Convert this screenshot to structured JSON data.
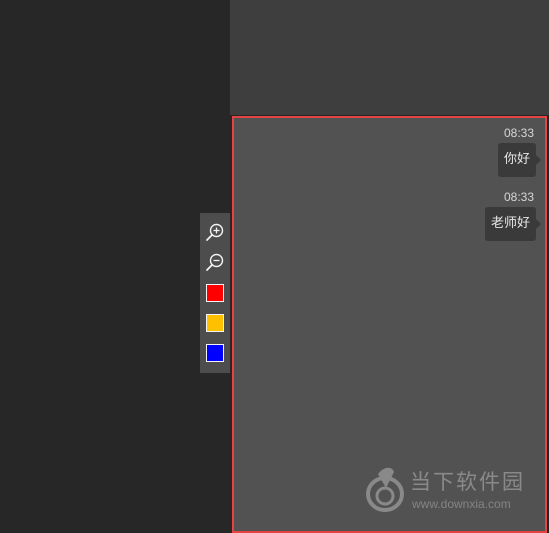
{
  "chat": {
    "messages": [
      {
        "time": "08:33",
        "text": "你好"
      },
      {
        "time": "08:33",
        "text": "老师好"
      }
    ]
  },
  "toolbar": {
    "tools": [
      {
        "name": "zoom-in",
        "icon": "zoom-in-icon"
      },
      {
        "name": "zoom-out",
        "icon": "zoom-out-icon"
      }
    ],
    "colors": [
      "#ff0000",
      "#ffc000",
      "#0000ff"
    ]
  },
  "watermark": {
    "brand": "当下软件园",
    "url": "www.downxia.com"
  },
  "theme": {
    "panel_border": "#e84343",
    "panel_bg": "#525252",
    "bubble_bg": "#3a3a3a"
  }
}
